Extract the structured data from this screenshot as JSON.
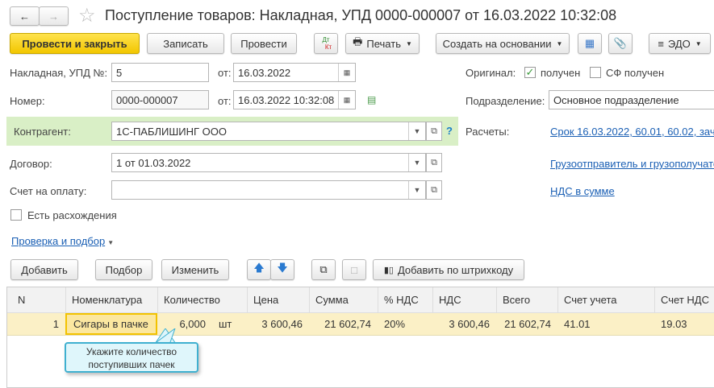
{
  "title": "Поступление товаров: Накладная, УПД 0000-000007 от 16.03.2022 10:32:08",
  "toolbar": {
    "post_close": "Провести и закрыть",
    "save": "Записать",
    "post": "Провести",
    "dtkt_dt": "Дт",
    "dtkt_kt": "Кт",
    "print": "Печать",
    "create_based": "Создать на основании",
    "edo": "ЭДО"
  },
  "form": {
    "invoice_label": "Накладная, УПД №:",
    "invoice_value": "5",
    "from_label": "от:",
    "invoice_date": "16.03.2022",
    "number_label": "Номер:",
    "number_value": "0000-000007",
    "number_date": "16.03.2022 10:32:08",
    "original_label": "Оригинал:",
    "received_label": "получен",
    "sf_received_label": "СФ получен",
    "division_label": "Подразделение:",
    "division_value": "Основное подразделение",
    "counterparty_label": "Контрагент:",
    "counterparty_value": "1С-ПАБЛИШИНГ ООО",
    "help": "?",
    "settlements_label": "Расчеты:",
    "settlements_link": "Срок 16.03.2022, 60.01, 60.02, зач",
    "contract_label": "Договор:",
    "contract_value": "1 от 01.03.2022",
    "shipper_link": "Грузоотправитель и грузополучате",
    "payment_label": "Счет на оплату:",
    "payment_value": "",
    "vat_link": "НДС в сумме",
    "discrepancy_label": "Есть расхождения",
    "check_link": "Проверка и подбор"
  },
  "table_toolbar": {
    "add": "Добавить",
    "pick": "Подбор",
    "edit": "Изменить",
    "barcode": "Добавить по штрихкоду"
  },
  "table": {
    "headers": [
      "N",
      "Номенклатура",
      "Количество",
      "Цена",
      "Сумма",
      "% НДС",
      "НДС",
      "Всего",
      "Счет учета",
      "Счет НДС"
    ],
    "rows": [
      [
        "1",
        "Сигары в пачке",
        "6,000",
        "шт",
        "3 600,46",
        "21 602,74",
        "20%",
        "3 600,46",
        "21 602,74",
        "41.01",
        "19.03"
      ]
    ]
  },
  "tooltip": {
    "line1": "Укажите количество",
    "line2": "поступивших пачек"
  }
}
